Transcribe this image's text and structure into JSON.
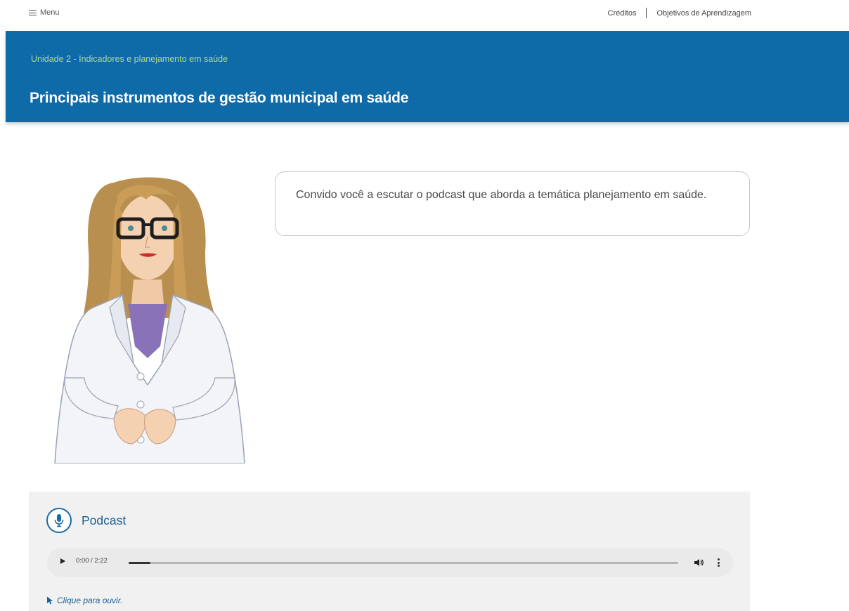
{
  "nav": {
    "menu_label": "Menu",
    "links": [
      "Créditos",
      "Objetivos de Aprendizagem"
    ]
  },
  "header": {
    "unit": "Unidade 2 - Indicadores e planejamento em saúde",
    "title": "Principais instrumentos de gestão municipal em saúde"
  },
  "bubble": {
    "text": "Convido você a escutar o podcast que aborda a temática planejamento em saúde."
  },
  "podcast": {
    "title": "Podcast",
    "time": "0:00 / 2:22",
    "progress_fraction": 0.04,
    "hint": "Clique para ouvir."
  },
  "colors": {
    "header_bg": "#0f6aa8",
    "unit_text": "#a6e07a",
    "accent": "#1a6aa7",
    "podcast_bg": "#f1f1f1"
  },
  "icons": [
    "menu-icon",
    "person-illustration",
    "microphone-icon",
    "play-icon",
    "volume-icon",
    "more-options-icon",
    "cursor-icon"
  ]
}
